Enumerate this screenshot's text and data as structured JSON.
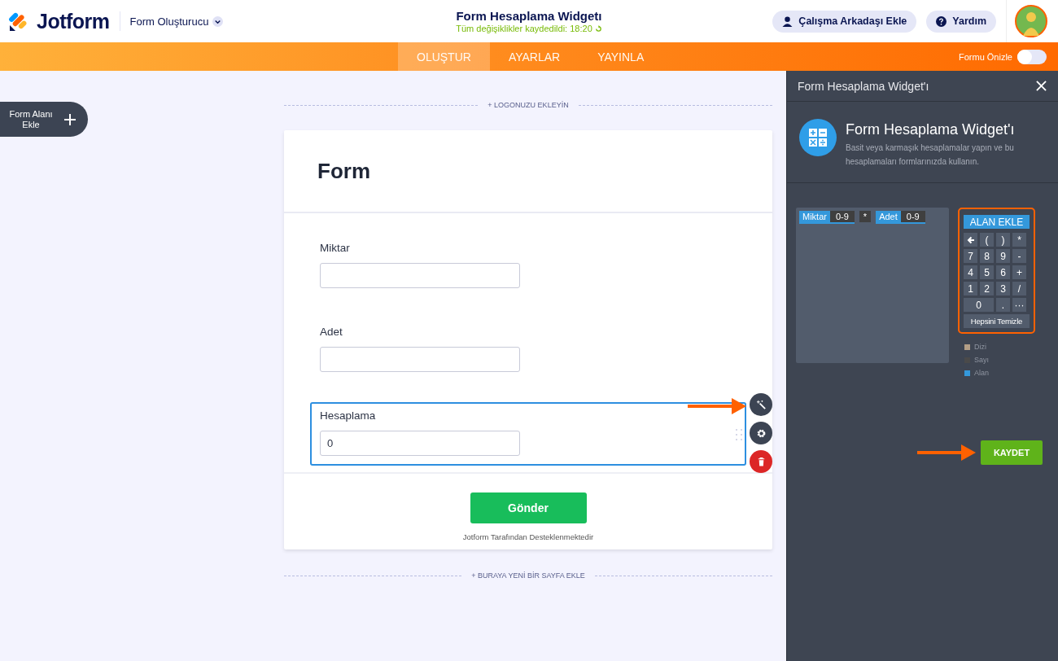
{
  "header": {
    "logo": "Jotform",
    "builder_menu": "Form Oluşturucu",
    "title": "Form Hesaplama Widgetı",
    "save_status": "Tüm değişiklikler kaydedildi: 18:20",
    "buttons": [
      {
        "label": "Çalışma Arkadaşı Ekle",
        "kind": "person"
      },
      {
        "label": "Yardım",
        "kind": "help"
      }
    ]
  },
  "nav": {
    "tabs": [
      {
        "label": "OLUŞTUR",
        "selected": true
      },
      {
        "label": "AYARLAR",
        "selected": false
      },
      {
        "label": "YAYINLA",
        "selected": false
      }
    ],
    "preview": {
      "label": "Formu Önizle",
      "on": false
    }
  },
  "add_field_button": "Form Alanı Ekle",
  "canvas": {
    "add_logo": "+ LOGONUZU EKLEYİN",
    "form_title": "Form",
    "fields": [
      {
        "label": "Miktar",
        "selected": false
      },
      {
        "label": "Adet",
        "selected": false
      },
      {
        "label": "Hesaplama",
        "value": "0",
        "selected": true
      }
    ],
    "submit": "Gönder",
    "powered_by": "Jotform Tarafından Desteklenmektedir",
    "add_page": "+ BURAYA YENİ BİR SAYFA EKLE"
  },
  "panel": {
    "title": "Form Hesaplama Widget'ı",
    "widget_name": "Form Hesaplama Widget'ı",
    "description": "Basit veya karmaşık hesaplamalar yapın ve bu hesaplamaları formlarınızda kullanın.",
    "expression": [
      {
        "kind": "field",
        "label": "Miktar",
        "format": "0-9"
      },
      {
        "kind": "operator",
        "label": "*"
      },
      {
        "kind": "field",
        "label": "Adet",
        "format": "0-9"
      }
    ],
    "calculator": {
      "add_field": "ALAN EKLE",
      "keys": [
        {
          "kind": "backspace"
        },
        {
          "kind": "key",
          "label": "("
        },
        {
          "kind": "key",
          "label": ")"
        },
        {
          "kind": "key",
          "label": "*"
        },
        {
          "kind": "key",
          "label": "7"
        },
        {
          "kind": "key",
          "label": "8"
        },
        {
          "kind": "key",
          "label": "9"
        },
        {
          "kind": "key",
          "label": "-"
        },
        {
          "kind": "key",
          "label": "4"
        },
        {
          "kind": "key",
          "label": "5"
        },
        {
          "kind": "key",
          "label": "6"
        },
        {
          "kind": "key",
          "label": "+"
        },
        {
          "kind": "key",
          "label": "1"
        },
        {
          "kind": "key",
          "label": "2"
        },
        {
          "kind": "key",
          "label": "3"
        },
        {
          "kind": "key",
          "label": "/"
        },
        {
          "kind": "wide",
          "label": "0"
        },
        {
          "kind": "key",
          "label": "."
        },
        {
          "kind": "key",
          "label": "···"
        }
      ],
      "clear": "Hepsini Temizle"
    },
    "legend": [
      {
        "label": "Dizi",
        "color": "#b39e86"
      },
      {
        "label": "Sayı",
        "color": "#4a4a4a"
      },
      {
        "label": "Alan",
        "color": "#3498db"
      }
    ],
    "save": "KAYDET"
  }
}
